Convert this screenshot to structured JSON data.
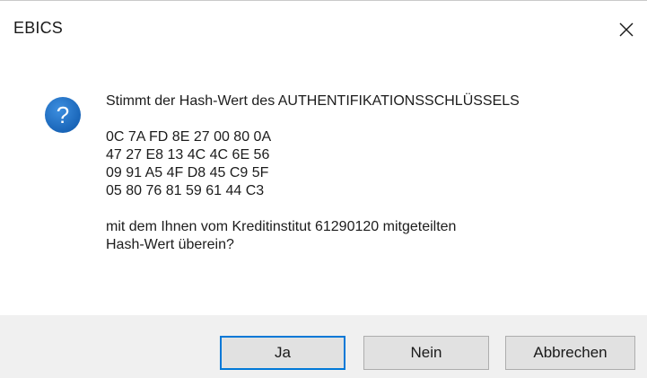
{
  "window": {
    "title": "EBICS"
  },
  "message": {
    "intro": "Stimmt der Hash-Wert des AUTHENTIFIKATIONSSCHLÜSSELS",
    "hash_lines": [
      "0C 7A FD 8E 27 00 80 0A",
      "47 27 E8 13 4C 4C 6E 56",
      "09 91 A5 4F D8 45 C9 5F",
      "05 80 76 81 59 61 44 C3"
    ],
    "outro_line1": "mit dem Ihnen vom Kreditinstitut 61290120 mitgeteilten",
    "outro_line2": "Hash-Wert überein?"
  },
  "buttons": {
    "yes": "Ja",
    "no": "Nein",
    "cancel": "Abbrechen"
  },
  "icons": {
    "question": "question-icon",
    "close": "close-icon"
  },
  "colors": {
    "question_icon": "#1a6fc4",
    "default_button_border": "#0078d7",
    "button_bar": "#f0f0f0"
  }
}
